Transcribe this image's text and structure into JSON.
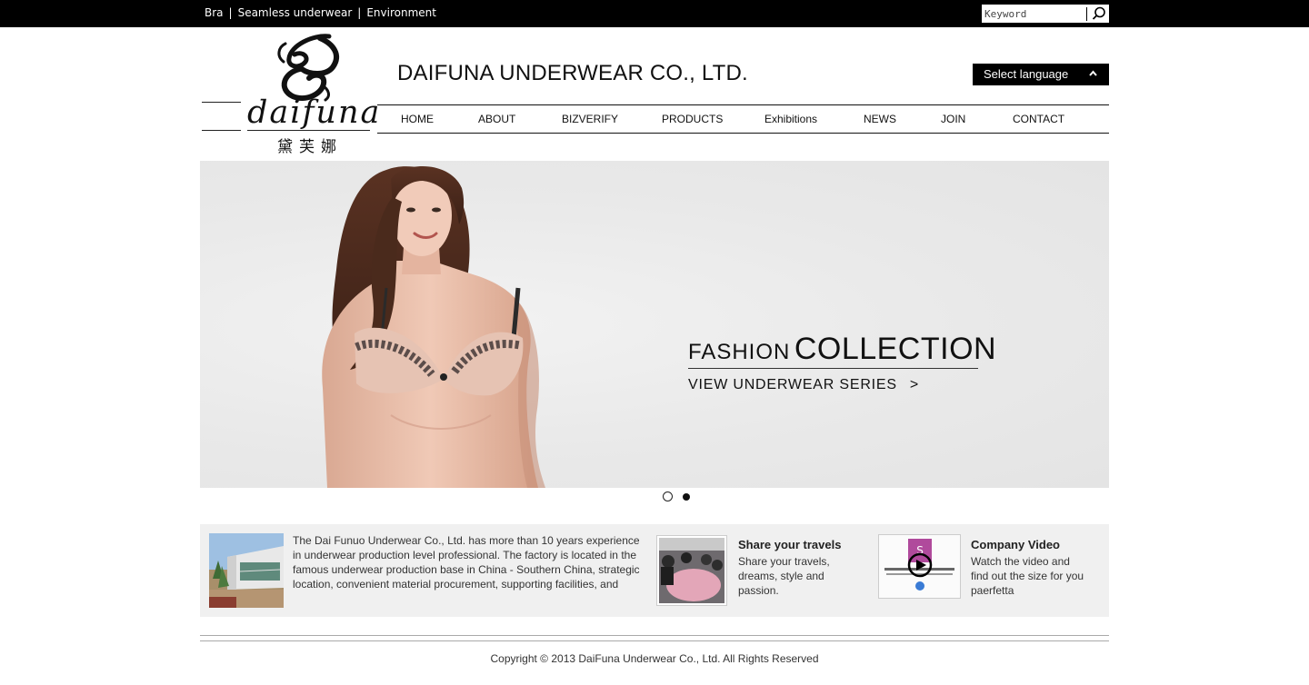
{
  "topbar": {
    "links": [
      "Bra",
      "Seamless underwear",
      "Environment"
    ],
    "search_placeholder": "Keyword"
  },
  "header": {
    "logo_text": "daifuna",
    "logo_cn": "黛芙娜",
    "company_name": "DAIFUNA UNDERWEAR CO., LTD.",
    "language_label": "Select language"
  },
  "nav": {
    "items": [
      "HOME",
      "ABOUT",
      "BIZVERIFY",
      "PRODUCTS",
      "Exhibitions",
      "NEWS",
      "JOIN",
      "CONTACT"
    ]
  },
  "banner": {
    "fashion_small": "FASHION",
    "fashion_big": "COLLECTION",
    "view_series": "VIEW UNDERWEAR SERIES",
    "arrow": ">",
    "slide_count": 2,
    "active_slide": 2
  },
  "strip": {
    "about": "The Dai Funuo Underwear Co., Ltd. has more than 10 years experience in underwear production level professional. The factory is located in the famous underwear production base in China - Southern China, strategic location, convenient material procurement, supporting facilities, and",
    "travel_title": "Share your travels",
    "travel_desc": "Share your travels, dreams, style and passion.",
    "video_title": "Company Video",
    "video_desc": "Watch the video and find out the size for you paerfetta"
  },
  "footer": {
    "copyright": "Copyright © 2013 DaiFuna Underwear Co., Ltd. All Rights Reserved"
  }
}
